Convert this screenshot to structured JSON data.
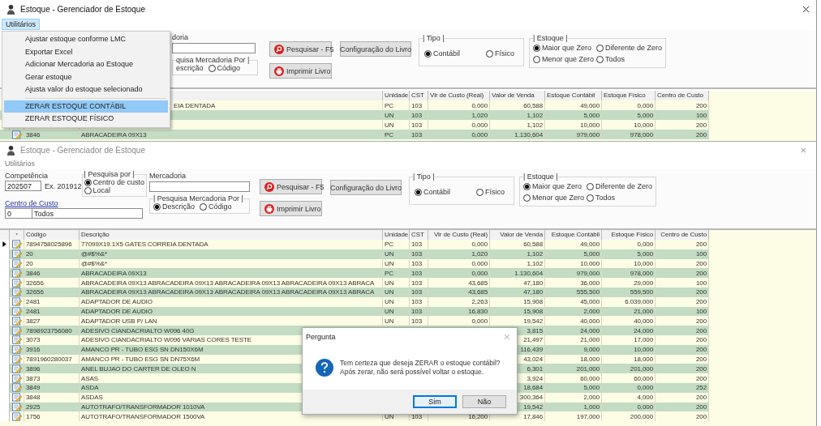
{
  "back_window": {
    "title": "Estoque - Gerenciador de Estoque",
    "active": true,
    "menu_bar": [
      {
        "label": "Utilitários",
        "selected": true
      }
    ],
    "form": {
      "mercadoria_label": "doria",
      "mercadoria_search_by": {
        "legend": "quisa Mercadoria Por |",
        "options": [
          {
            "label": "escrição",
            "kind": "text"
          },
          {
            "label": "Código",
            "kind": "radio",
            "selected": false
          }
        ]
      },
      "buttons": [
        {
          "label": "Pesquisar - F5",
          "kind": "search"
        },
        {
          "label": "Imprimir Livro",
          "kind": "print"
        },
        {
          "label": "Configuração do Livro",
          "kind": "plain"
        }
      ],
      "tipo": {
        "legend": "| Tipo |",
        "options": [
          {
            "label": "Contábil",
            "selected": true
          },
          {
            "label": "Físico",
            "selected": false
          }
        ]
      },
      "estoque": {
        "legend": "| Estoque |",
        "options": [
          {
            "label": "Maior que Zero",
            "selected": true
          },
          {
            "label": "Diferente de Zero",
            "selected": false
          },
          {
            "label": "Menor que Zero",
            "selected": false
          },
          {
            "label": "Todos",
            "selected": false
          }
        ]
      }
    },
    "table": {
      "columns": [
        "Unidade",
        "CST",
        "Vlr de Custo (Real)",
        "Valor de Venda",
        "Estoque Contábil",
        "Estoque Físico",
        "Centro de Custo"
      ],
      "rows": [
        {
          "description": "EIA DENTADA",
          "cut": true,
          "unit": "PC",
          "cst": "103",
          "cost": "0,000",
          "price": "60,588",
          "stock_accounting": "49,000",
          "stock_physical": "0,000",
          "cost_center": "200"
        },
        {
          "unit": "UN",
          "cst": "103",
          "cost": "1,020",
          "price": "1,102",
          "stock_accounting": "5,000",
          "stock_physical": "5,000",
          "cost_center": "100"
        },
        {
          "unit": "UN",
          "cst": "103",
          "cost": "0,000",
          "price": "1,102",
          "stock_accounting": "10,000",
          "stock_physical": "10,000",
          "cost_center": "200"
        },
        {
          "code": "3846",
          "description": "ABRACADEIRA 09X13",
          "unit": "PC",
          "cst": "103",
          "cost": "0,000",
          "price": "1.130,604",
          "stock_accounting": "979,000",
          "stock_physical": "978,000",
          "cost_center": "200"
        }
      ]
    }
  },
  "dropdown_menu": {
    "items": [
      {
        "kind": "item",
        "label": "Ajustar estoque conforme LMC",
        "selected": false
      },
      {
        "kind": "item",
        "label": "Exportar Excel",
        "selected": false
      },
      {
        "kind": "item",
        "label": "Adicionar Mercadoria ao Estoque",
        "selected": false
      },
      {
        "kind": "item",
        "label": "Gerar estoque",
        "selected": false
      },
      {
        "kind": "item",
        "label": "Ajusta valor do estoque selecionado",
        "selected": false
      },
      {
        "kind": "separator"
      },
      {
        "kind": "item",
        "label": "ZERAR ESTOQUE CONTÁBIL",
        "selected": true
      },
      {
        "kind": "item",
        "label": "ZERAR ESTOQUE FÍSICO",
        "selected": false
      }
    ]
  },
  "front_window": {
    "title": "Estoque - Gerenciador de Estoque",
    "active": false,
    "close": "×",
    "menu_bar": [
      {
        "label": "Utilitários",
        "selected": false
      }
    ],
    "form": {
      "competencia_label": "Competência",
      "competencia_value": "202507",
      "competencia_hint": "Ex. 201912",
      "pesquisa_por": {
        "legend": "| Pesquisa por |",
        "options": [
          {
            "label": "Centro de custo",
            "selected": true
          },
          {
            "label": "Local",
            "selected": false
          }
        ]
      },
      "centro_link": "Centro de Custo",
      "centro_code": "0",
      "centro_name": "Todos",
      "mercadoria_label": "Mercadoria",
      "mercadoria_search_by": {
        "legend": "| Pesquisa Mercadoria Por |",
        "options": [
          {
            "label": "Descrição",
            "kind": "radio",
            "selected": true
          },
          {
            "label": "Código",
            "kind": "radio",
            "selected": false
          }
        ]
      },
      "buttons": [
        {
          "label": "Pesquisar - F5",
          "kind": "search"
        },
        {
          "label": "Imprimir Livro",
          "kind": "print"
        },
        {
          "label": "Configuração do Livro",
          "kind": "plain"
        }
      ],
      "tipo": {
        "legend": "| Tipo |",
        "options": [
          {
            "label": "Contábil",
            "selected": true
          },
          {
            "label": "Físico",
            "selected": false
          }
        ]
      },
      "estoque": {
        "legend": "| Estoque |",
        "options": [
          {
            "label": "Maior que Zero",
            "selected": true
          },
          {
            "label": "Diferente de Zero",
            "selected": false
          },
          {
            "label": "Menor que Zero",
            "selected": false
          },
          {
            "label": "Todos",
            "selected": false
          }
        ]
      }
    },
    "table": {
      "columns": [
        "*",
        "Código",
        "Descrição",
        "Unidade",
        "CST",
        "Vlr de Custo (Real)",
        "Valor de Venda",
        "Estoque Contábil",
        "Estoque Físico",
        "Centro de Custo"
      ],
      "rows": [
        {
          "selected": true,
          "code": "7894758025896",
          "description": "77099X19.1X5 GATES CORREIA DENTADA",
          "unit": "PC",
          "cst": "103",
          "cost": "0,000",
          "price": "60,588",
          "stock_accounting": "49,000",
          "stock_physical": "0,000",
          "cost_center": "200"
        },
        {
          "selected": false,
          "code": "20",
          "description": "@#$%&*",
          "unit": "UN",
          "cst": "103",
          "cost": "1,020",
          "price": "1,102",
          "stock_accounting": "5,000",
          "stock_physical": "5,000",
          "cost_center": "100"
        },
        {
          "selected": false,
          "code": "20",
          "description": "@#$%&*",
          "unit": "UN",
          "cst": "103",
          "cost": "0,000",
          "price": "1,102",
          "stock_accounting": "10,000",
          "stock_physical": "10,000",
          "cost_center": "200"
        },
        {
          "selected": false,
          "code": "3846",
          "description": "ABRACADEIRA 09X13",
          "unit": "PC",
          "cst": "103",
          "cost": "0,000",
          "price": "1.130,604",
          "stock_accounting": "979,000",
          "stock_physical": "978,000",
          "cost_center": "200"
        },
        {
          "selected": false,
          "code": "32656",
          "description": "ABRACADEIRA 09X13 ABRACADEIRA 09X13 ABRACADEIRA 09X13 ABRACADEIRA 09X13 ABRACA",
          "unit": "UN",
          "cst": "103",
          "cost": "43,685",
          "price": "47,180",
          "stock_accounting": "36,000",
          "stock_physical": "29,000",
          "cost_center": "100"
        },
        {
          "selected": false,
          "code": "32656",
          "description": "ABRACADEIRA 09X13 ABRACADEIRA 09X13 ABRACADEIRA 09X13 ABRACADEIRA 09X13 ABRACA",
          "unit": "UN",
          "cst": "103",
          "cost": "43,685",
          "price": "47,180",
          "stock_accounting": "555,500",
          "stock_physical": "559,500",
          "cost_center": "200"
        },
        {
          "selected": false,
          "code": "2481",
          "description": "ADAPTADOR DE AUDIO",
          "unit": "UN",
          "cst": "103",
          "cost": "2,263",
          "price": "15,908",
          "stock_accounting": "45,000",
          "stock_physical": "6.039,000",
          "cost_center": "200"
        },
        {
          "selected": false,
          "code": "2481",
          "description": "ADAPTADOR DE AUDIO",
          "unit": "UN",
          "cst": "103",
          "cost": "16,830",
          "price": "15,908",
          "stock_accounting": "2,000",
          "stock_physical": "21,000",
          "cost_center": "100"
        },
        {
          "selected": false,
          "code": "3827",
          "description": "ADAPTADOR USB P/ LAN",
          "unit": "UN",
          "cst": "103",
          "cost": "0,000",
          "price": "19,542",
          "stock_accounting": "40,000",
          "stock_physical": "40,000",
          "cost_center": "200"
        },
        {
          "selected": false,
          "code": "7898923756080",
          "description": "ADESIVO CIANDACRIALTO W096 40G",
          "price": "3,815",
          "stock_accounting": "24,000",
          "stock_physical": "24,000",
          "cost_center": "200"
        },
        {
          "selected": false,
          "code": "3073",
          "description": "ADESIVO CIANDACRIALTO W096 VARIAS CORES TESTE",
          "price": "21,497",
          "stock_accounting": "21,000",
          "stock_physical": "17,000",
          "cost_center": "200"
        },
        {
          "selected": false,
          "code": "3916",
          "description": "AMANCO PR - TUBO ESG SN DN150X6M",
          "price": "116,439",
          "stock_accounting": "9,000",
          "stock_physical": "10,000",
          "cost_center": "200"
        },
        {
          "selected": false,
          "code": "7891960280037",
          "description": "AMANCO PR - TUBO ESG SN DN75X6M",
          "price": "43,024",
          "stock_accounting": "18,000",
          "stock_physical": "18,000",
          "cost_center": "200"
        },
        {
          "selected": false,
          "code": "3896",
          "description": "ANEL BUJAO DO CARTER DE OLEO N",
          "price": "6,301",
          "stock_accounting": "201,000",
          "stock_physical": "201,000",
          "cost_center": "200"
        },
        {
          "selected": false,
          "code": "3873",
          "description": "ASAS",
          "price": "3,924",
          "stock_accounting": "60,000",
          "stock_physical": "60,000",
          "cost_center": "200"
        },
        {
          "selected": false,
          "code": "3849",
          "description": "ASDA",
          "price": "18,684",
          "stock_accounting": "5,000",
          "stock_physical": "0,000",
          "cost_center": "252"
        },
        {
          "selected": false,
          "code": "3848",
          "description": "ASDAS",
          "price": "300,364",
          "stock_accounting": "2,000",
          "stock_physical": "4,000",
          "cost_center": "200"
        },
        {
          "selected": false,
          "code": "2925",
          "description": "AUTOTRAFO/TRANSFORMADOR 1010VA",
          "price": "19,542",
          "stock_accounting": "1,000",
          "stock_physical": "0,000",
          "cost_center": "200"
        },
        {
          "selected": false,
          "code": "1756",
          "description": "AUTOTRAFO/TRANSFORMADOR 1500VA",
          "unit": "UN",
          "cst": "103",
          "cost": "16,200",
          "price": "17,846",
          "stock_accounting": "197,000",
          "stock_physical": "200,000",
          "cost_center": "200"
        }
      ]
    }
  },
  "dialog": {
    "title": "Pergunta",
    "close": "×",
    "message": "Tem certeza que deseja ZERAR o estoque contábil?\nApós zerar, não será possível voltar o estoque.",
    "buttons": [
      {
        "label": "Sim",
        "selected": true
      },
      {
        "label": "Não",
        "selected": false
      }
    ]
  }
}
